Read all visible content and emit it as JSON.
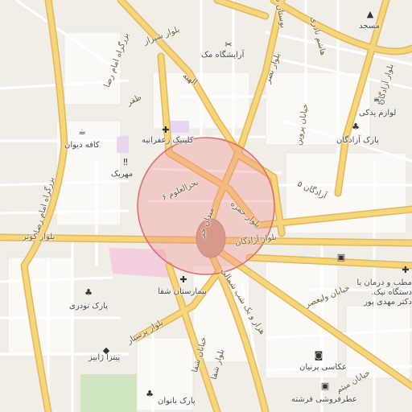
{
  "colors": {
    "background": "#f1eee8",
    "block": "#faf9f6",
    "minor_road": "#ffffff",
    "major_road": "#f7d57a",
    "major_road_casing": "#e3b75a",
    "hospital_area": "#f4cfe0",
    "park_area": "#cfe6c0",
    "plaza": "#c9a18a",
    "selection_fill": "#f08a8a",
    "selection_stroke": "#e06a6a"
  },
  "labels": {
    "street_bustan": "بوستان ششم",
    "street_hashem": "هاشم نادری",
    "mosque": "مسجد",
    "blvd_shiraz": "بلوار شیراز",
    "beauty_salon": "آرایشگاه مک",
    "blvd_nasr": "بلوار نصر",
    "highway_imam_reza_top": "بزرگراه امام رضا",
    "elahiyeh": "الهیه",
    "zafar": "ظفر",
    "yadaki": "لوازم یدکی",
    "cafe_divan": "کافه دیوان",
    "clinic_zaferanieh": "کلینیک زعفرانیه",
    "st_parvin": "خیابان پروین",
    "park_azadegan": "پارک آزادگان",
    "blvd_azadegan_top": "بلوار آزادگان",
    "mehrik": "مهریک",
    "azadegan_5": "آزادگان ۵",
    "bahr_olaloom": "بحرالعلوم ۶",
    "highway_imam_reza_left": "بزرگراه امام رضا",
    "blvd_hamzeh": "بلوار حمزه",
    "meydan_hor": "میدان حر",
    "blvd_kowsar": "بلوار کوثر",
    "blvd_azadegan": "بلوار آزادگان",
    "clinic_dastgah": "مطب و درمان با دستگاه نیک. دکتر مهدی پور",
    "park_nodari": "پارک نودری",
    "hospital_shafa": "بیمارستان شفا",
    "st_valiasr": "خیابان ولیعصر",
    "hezar_yek_shab": "هزار و یک شب شمالی",
    "blvd_parastar": "بلوار پرستار",
    "st_shafa": "خیابان شفا",
    "pizza": "پیتزا ژابیز",
    "photo": "عکاسی پرنیان",
    "st_meysam": "خیابان میثم",
    "park_banovan": "پارک بانوان",
    "perfume": "عطرفروشی فرشته",
    "blvd_shafa": "بلوار شفا"
  },
  "icons": {
    "mosque": "mosque-icon",
    "beauty_salon": "scissors-icon",
    "car_parts": "car-icon",
    "cafe": "coffee-cup-icon",
    "clinic": "medical-cross-icon",
    "park": "tree-icon",
    "restaurant": "fork-knife-icon",
    "hospital": "medical-cross-icon",
    "pizza": "pizza-icon",
    "photo": "camera-icon",
    "perfume": "shopping-bag-icon",
    "shop": "bag-icon"
  }
}
